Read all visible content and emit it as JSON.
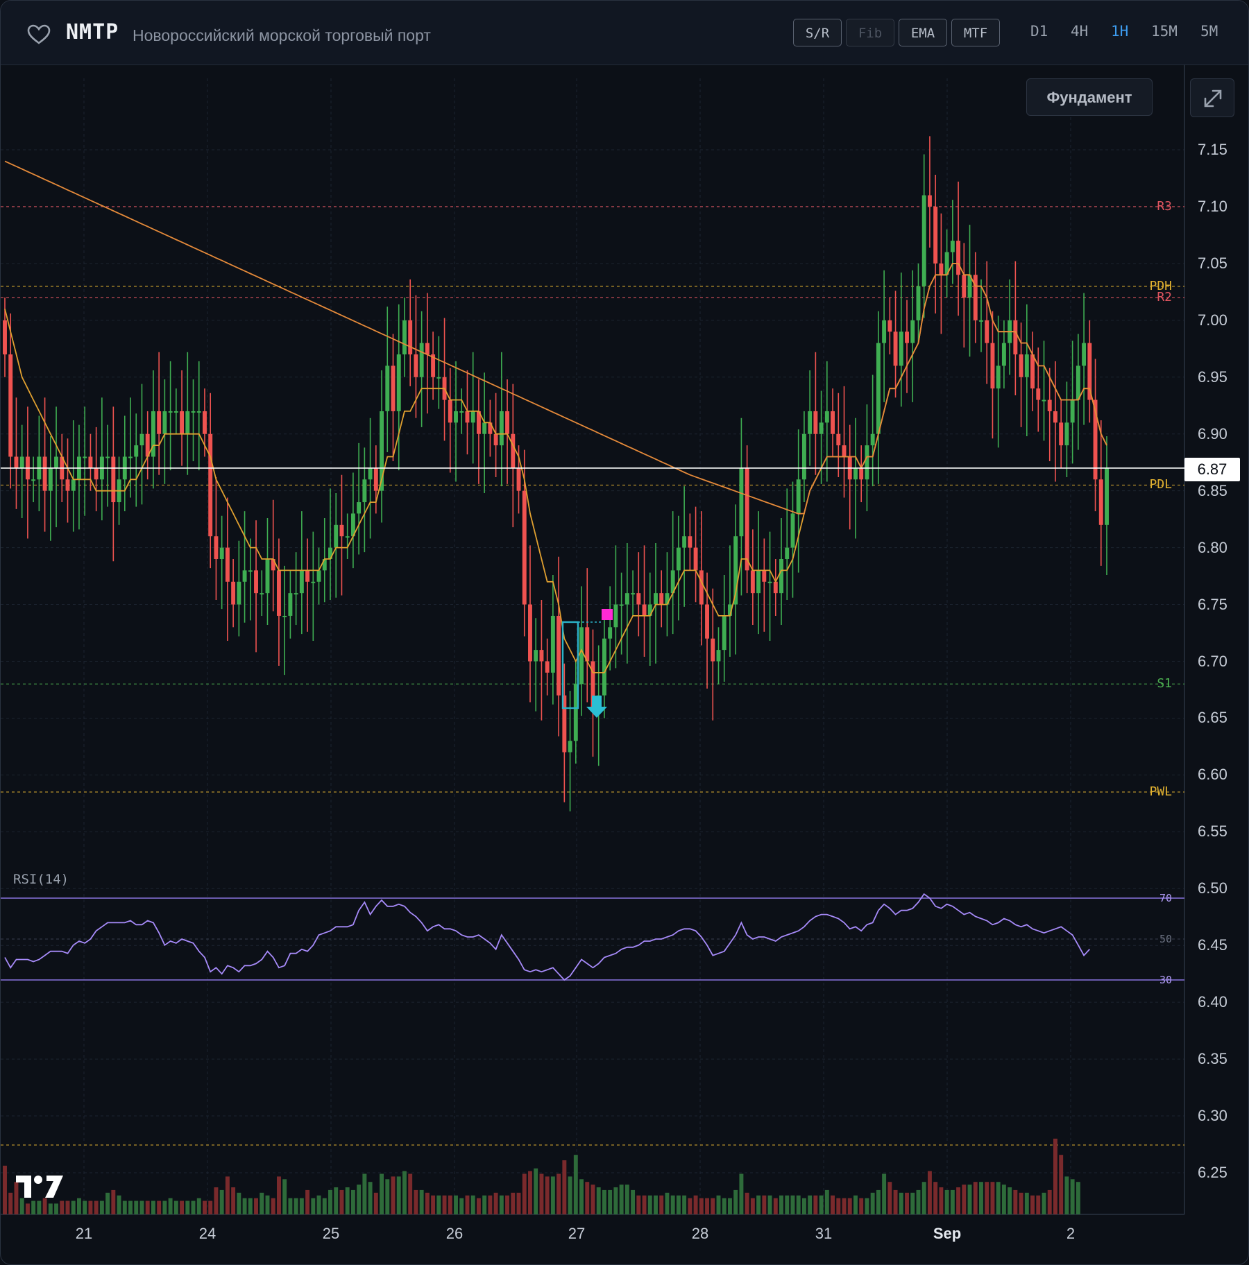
{
  "header": {
    "ticker": "NMTP",
    "company": "Новороссийский морской торговый порт",
    "tools": [
      {
        "label": "S/R",
        "enabled": true
      },
      {
        "label": "Fib",
        "enabled": false
      },
      {
        "label": "EMA",
        "enabled": true
      },
      {
        "label": "MTF",
        "enabled": true
      }
    ],
    "timeframes": [
      "D1",
      "4H",
      "1H",
      "15M",
      "5M"
    ],
    "active_timeframe": "1H"
  },
  "overlay": {
    "fundamentals_label": "Фундамент"
  },
  "colors": {
    "up": "#3fae52",
    "down": "#ef5350",
    "ema_fast": "#e0a030",
    "ema_slow": "#e58a3a",
    "resistance": "#e05560",
    "support": "#4caf50",
    "prev_levels": "#e0b030",
    "rsi": "#a78bfa",
    "accent": "#3d9cf0"
  },
  "icons": {
    "favorite": "heart-outline-icon",
    "expand": "expand-diagonal-icon",
    "logo": "tradingview-logo-icon",
    "signal": "down-arrow-signal-icon",
    "marker": "square-marker-icon"
  },
  "chart_data": {
    "type": "candlestick",
    "title": "NMTP",
    "timeframe": "1H",
    "y_ticks": [
      "7.15",
      "7.10",
      "7.05",
      "7.00",
      "6.95",
      "6.90",
      "6.85",
      "6.80",
      "6.75",
      "6.70",
      "6.65",
      "6.60",
      "6.55",
      "6.50",
      "6.45",
      "6.40",
      "6.35",
      "6.30",
      "6.25"
    ],
    "ylim": [
      6.215,
      7.215
    ],
    "x_ticks": [
      "21",
      "24",
      "25",
      "26",
      "27",
      "28",
      "31",
      "Sep",
      "2"
    ],
    "last_price": "6.87",
    "levels": [
      {
        "label": "R3",
        "value": 7.1,
        "kind": "resistance"
      },
      {
        "label": "PDH",
        "value": 7.03,
        "kind": "prev"
      },
      {
        "label": "R2",
        "value": 7.02,
        "kind": "resistance"
      },
      {
        "label": "PDL",
        "value": 6.855,
        "kind": "prev"
      },
      {
        "label": "S1",
        "value": 6.68,
        "kind": "support"
      },
      {
        "label": "PWL",
        "value": 6.585,
        "kind": "prev"
      }
    ],
    "closes": [
      6.97,
      6.88,
      6.87,
      6.88,
      6.86,
      6.86,
      6.88,
      6.85,
      6.87,
      6.88,
      6.86,
      6.85,
      6.86,
      6.88,
      6.88,
      6.87,
      6.86,
      6.88,
      6.88,
      6.84,
      6.86,
      6.88,
      6.88,
      6.89,
      6.9,
      6.88,
      6.92,
      6.9,
      6.92,
      6.92,
      6.92,
      6.9,
      6.92,
      6.92,
      6.92,
      6.9,
      6.81,
      6.79,
      6.8,
      6.77,
      6.75,
      6.77,
      6.78,
      6.78,
      6.76,
      6.76,
      6.79,
      6.78,
      6.74,
      6.74,
      6.76,
      6.76,
      6.78,
      6.77,
      6.77,
      6.78,
      6.79,
      6.8,
      6.82,
      6.81,
      6.81,
      6.83,
      6.84,
      6.86,
      6.87,
      6.85,
      6.92,
      6.96,
      6.92,
      6.97,
      7.0,
      6.97,
      6.95,
      6.98,
      6.97,
      6.95,
      6.95,
      6.93,
      6.91,
      6.92,
      6.92,
      6.91,
      6.92,
      6.9,
      6.91,
      6.9,
      6.89,
      6.92,
      6.9,
      6.87,
      6.85,
      6.75,
      6.7,
      6.71,
      6.7,
      6.69,
      6.74,
      6.67,
      6.62,
      6.63,
      6.68,
      6.73,
      6.7,
      6.66,
      6.67,
      6.72,
      6.73,
      6.75,
      6.75,
      6.76,
      6.76,
      6.75,
      6.74,
      6.75,
      6.76,
      6.75,
      6.76,
      6.78,
      6.8,
      6.81,
      6.8,
      6.78,
      6.75,
      6.72,
      6.7,
      6.71,
      6.74,
      6.75,
      6.81,
      6.87,
      6.78,
      6.76,
      6.78,
      6.77,
      6.77,
      6.76,
      6.79,
      6.8,
      6.83,
      6.86,
      6.9,
      6.92,
      6.9,
      6.91,
      6.92,
      6.9,
      6.89,
      6.88,
      6.86,
      6.87,
      6.86,
      6.89,
      6.9,
      6.98,
      7.0,
      6.99,
      6.96,
      6.99,
      6.98,
      7.0,
      7.03,
      7.11,
      7.1,
      7.05,
      7.04,
      7.06,
      7.07,
      7.04,
      7.02,
      7.04,
      7.0,
      7.0,
      6.98,
      6.94,
      6.96,
      6.98,
      7.0,
      6.97,
      6.95,
      6.97,
      6.94,
      6.93,
      6.93,
      6.92,
      6.91,
      6.89,
      6.91,
      6.93,
      6.96,
      6.98,
      6.93,
      6.86,
      6.82,
      6.87
    ],
    "ema_fast": [
      7.01,
      6.99,
      6.97,
      6.95,
      6.94,
      6.93,
      6.92,
      6.91,
      6.9,
      6.89,
      6.88,
      6.87,
      6.86,
      6.86,
      6.86,
      6.86,
      6.85,
      6.85,
      6.85,
      6.85,
      6.85,
      6.85,
      6.86,
      6.86,
      6.87,
      6.88,
      6.89,
      6.89,
      6.9,
      6.9,
      6.9,
      6.9,
      6.9,
      6.9,
      6.9,
      6.89,
      6.88,
      6.86,
      6.85,
      6.84,
      6.83,
      6.82,
      6.81,
      6.8,
      6.8,
      6.79,
      6.79,
      6.79,
      6.78,
      6.78,
      6.78,
      6.78,
      6.78,
      6.78,
      6.78,
      6.78,
      6.79,
      6.79,
      6.8,
      6.8,
      6.8,
      6.81,
      6.82,
      6.83,
      6.84,
      6.84,
      6.86,
      6.88,
      6.88,
      6.9,
      6.92,
      6.92,
      6.93,
      6.94,
      6.94,
      6.94,
      6.94,
      6.94,
      6.93,
      6.93,
      6.93,
      6.92,
      6.92,
      6.92,
      6.91,
      6.91,
      6.9,
      6.9,
      6.9,
      6.89,
      6.88,
      6.86,
      6.83,
      6.81,
      6.79,
      6.77,
      6.77,
      6.75,
      6.72,
      6.71,
      6.7,
      6.71,
      6.7,
      6.69,
      6.69,
      6.69,
      6.7,
      6.71,
      6.72,
      6.73,
      6.74,
      6.74,
      6.74,
      6.74,
      6.75,
      6.75,
      6.75,
      6.76,
      6.77,
      6.78,
      6.78,
      6.78,
      6.77,
      6.76,
      6.75,
      6.74,
      6.74,
      6.74,
      6.76,
      6.79,
      6.79,
      6.78,
      6.78,
      6.78,
      6.78,
      6.77,
      6.78,
      6.78,
      6.79,
      6.81,
      6.83,
      6.85,
      6.86,
      6.87,
      6.88,
      6.88,
      6.88,
      6.88,
      6.88,
      6.88,
      6.87,
      6.88,
      6.88,
      6.9,
      6.92,
      6.94,
      6.94,
      6.95,
      6.96,
      6.97,
      6.98,
      7.01,
      7.03,
      7.04,
      7.04,
      7.04,
      7.05,
      7.05,
      7.04,
      7.04,
      7.03,
      7.03,
      7.02,
      7.0,
      6.99,
      6.99,
      6.99,
      6.99,
      6.98,
      6.98,
      6.97,
      6.96,
      6.96,
      6.95,
      6.94,
      6.93,
      6.93,
      6.93,
      6.93,
      6.94,
      6.94,
      6.92,
      6.9,
      6.89
    ],
    "rsi_levels": [
      70,
      50,
      30
    ],
    "rsi": [
      41,
      36,
      40,
      40,
      40,
      39,
      40,
      42,
      44,
      44,
      44,
      43,
      47,
      49,
      48,
      50,
      54,
      56,
      58,
      58,
      58,
      58,
      59,
      57,
      57,
      59,
      58,
      53,
      47,
      49,
      48,
      50,
      49,
      48,
      44,
      41,
      34,
      36,
      33,
      37,
      36,
      34,
      37,
      37,
      38,
      40,
      44,
      41,
      36,
      37,
      43,
      43,
      45,
      44,
      47,
      52,
      53,
      54,
      56,
      56,
      56,
      57,
      64,
      68,
      62,
      66,
      69,
      66,
      66,
      67,
      66,
      63,
      61,
      58,
      54,
      56,
      57,
      55,
      55,
      54,
      52,
      51,
      51,
      52,
      50,
      48,
      45,
      52,
      48,
      44,
      40,
      35,
      34,
      35,
      34,
      35,
      36,
      33,
      30,
      32,
      36,
      40,
      38,
      36,
      38,
      41,
      42,
      43,
      45,
      46,
      46,
      47,
      49,
      49,
      50,
      50,
      51,
      52,
      54,
      55,
      55,
      54,
      51,
      47,
      42,
      43,
      44,
      48,
      52,
      58,
      52,
      50,
      51,
      51,
      50,
      49,
      51,
      52,
      53,
      54,
      56,
      59,
      61,
      62,
      62,
      61,
      60,
      58,
      55,
      56,
      54,
      57,
      58,
      64,
      67,
      65,
      62,
      64,
      64,
      65,
      68,
      72,
      70,
      66,
      65,
      67,
      66,
      64,
      62,
      63,
      61,
      60,
      59,
      57,
      58,
      60,
      59,
      57,
      56,
      57,
      55,
      54,
      53,
      54,
      55,
      56,
      54,
      52,
      47,
      42,
      45
    ],
    "volume": [
      18,
      8,
      12,
      6,
      4,
      5,
      5,
      6,
      4,
      4,
      5,
      5,
      5,
      6,
      5,
      5,
      5,
      5,
      8,
      9,
      7,
      5,
      5,
      5,
      5,
      5,
      5,
      5,
      5,
      6,
      5,
      5,
      5,
      5,
      6,
      5,
      5,
      10,
      9,
      14,
      10,
      8,
      6,
      6,
      6,
      8,
      7,
      6,
      14,
      13,
      6,
      6,
      6,
      9,
      6,
      7,
      6,
      9,
      10,
      9,
      10,
      9,
      11,
      15,
      12,
      8,
      15,
      13,
      14,
      14,
      16,
      15,
      9,
      9,
      8,
      7,
      7,
      7,
      7,
      7,
      6,
      7,
      7,
      6,
      7,
      7,
      8,
      7,
      7,
      8,
      8,
      15,
      16,
      17,
      15,
      14,
      14,
      15,
      20,
      14,
      22,
      13,
      12,
      11,
      10,
      9,
      9,
      10,
      11,
      11,
      9,
      7,
      7,
      7,
      7,
      7,
      8,
      7,
      7,
      7,
      6,
      7,
      6,
      6,
      6,
      7,
      6,
      6,
      9,
      15,
      8,
      6,
      7,
      7,
      7,
      6,
      7,
      7,
      7,
      7,
      6,
      7,
      7,
      7,
      9,
      7,
      6,
      6,
      6,
      7,
      6,
      6,
      8,
      9,
      15,
      12,
      9,
      8,
      8,
      8,
      9,
      12,
      16,
      12,
      10,
      9,
      9,
      10,
      11,
      11,
      12,
      12,
      12,
      12,
      12,
      11,
      10,
      9,
      8,
      8,
      7,
      7,
      8,
      9,
      28,
      22,
      14,
      13,
      12
    ]
  }
}
